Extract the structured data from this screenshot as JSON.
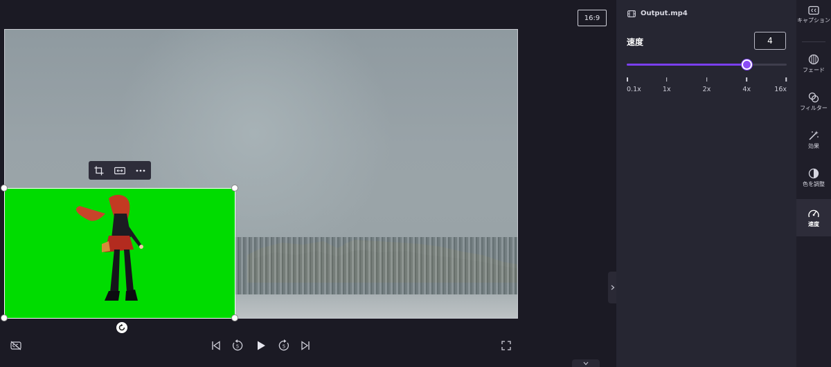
{
  "preview": {
    "aspect_ratio": "16:9",
    "clip_toolbar": {
      "icons": [
        "crop-icon",
        "fit-icon",
        "more-icon"
      ]
    },
    "controls": {
      "icons": [
        "captions-off-icon",
        "skip-start-icon",
        "rewind-5-icon",
        "play-icon",
        "forward-5-icon",
        "skip-end-icon",
        "fullscreen-icon"
      ],
      "rewind_seconds": "5",
      "forward_seconds": "5"
    }
  },
  "properties": {
    "file_name": "Output.mp4",
    "speed_label": "速度",
    "speed_value": "4",
    "slider": {
      "accent_color": "#7b3ff2",
      "ticks": [
        "0.1x",
        "1x",
        "2x",
        "4x",
        "16x"
      ],
      "selected_tick_index": 3
    }
  },
  "rail": {
    "items": [
      {
        "label": "キャプション",
        "icon": "cc-icon"
      },
      {
        "label": "フェード",
        "icon": "fade-icon"
      },
      {
        "label": "フィルター",
        "icon": "filter-icon"
      },
      {
        "label": "効果",
        "icon": "magic-wand-icon"
      },
      {
        "label": "色を調整",
        "icon": "color-adjust-icon"
      },
      {
        "label": "速度",
        "icon": "speedometer-icon",
        "active": true
      }
    ]
  }
}
